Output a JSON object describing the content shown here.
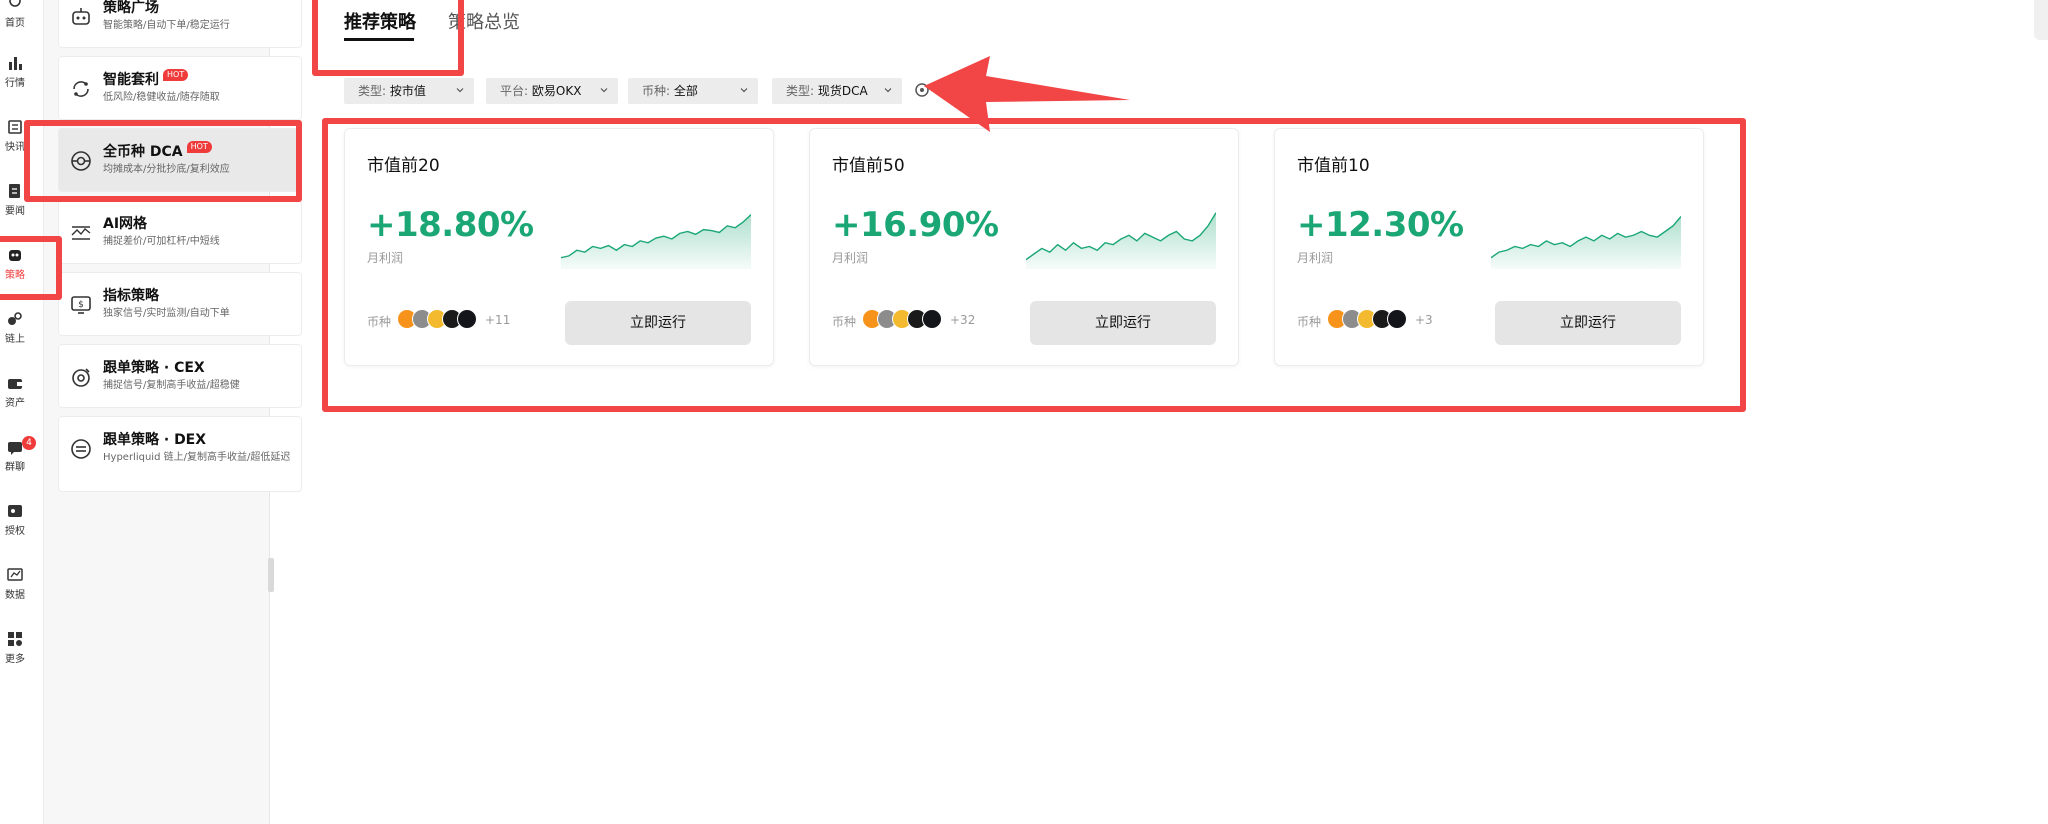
{
  "rail": {
    "items": [
      {
        "label": "首页",
        "icon": "home-icon"
      },
      {
        "label": "行情",
        "icon": "chart-bar-icon"
      },
      {
        "label": "快讯",
        "icon": "news-icon"
      },
      {
        "label": "要闻",
        "icon": "document-icon"
      },
      {
        "label": "策略",
        "icon": "robot-icon",
        "active": true
      },
      {
        "label": "链上",
        "icon": "chain-icon"
      },
      {
        "label": "资产",
        "icon": "wallet-icon"
      },
      {
        "label": "群聊",
        "icon": "chat-icon",
        "badge": "4"
      },
      {
        "label": "授权",
        "icon": "key-icon"
      },
      {
        "label": "数据",
        "icon": "data-icon"
      },
      {
        "label": "更多",
        "icon": "grid-icon"
      }
    ]
  },
  "menu": {
    "items": [
      {
        "title": "策略广场",
        "desc": "智能策略/自动下单/稳定运行",
        "icon": "robot-icon"
      },
      {
        "title": "智能套利",
        "desc": "低风险/稳健收益/随存随取",
        "icon": "cycle-icon",
        "hot": "HOT"
      },
      {
        "title": "全币种 DCA",
        "desc": "均摊成本/分批抄底/复利效应",
        "icon": "dca-icon",
        "hot": "HOT",
        "active": true
      },
      {
        "title": "AI网格",
        "desc": "捕捉差价/可加杠杆/中短线",
        "icon": "grid-trade-icon"
      },
      {
        "title": "指标策略",
        "desc": "独家信号/实时监测/自动下单",
        "icon": "indicator-icon"
      },
      {
        "title": "跟单策略 · CEX",
        "desc": "捕捉信号/复制高手收益/超稳健",
        "icon": "copy-cex-icon"
      },
      {
        "title": "跟单策略 · DEX",
        "desc": "Hyperliquid 链上/复制高手收益/超低延迟",
        "icon": "copy-dex-icon"
      }
    ]
  },
  "tabs": [
    {
      "label": "推荐策略",
      "active": true
    },
    {
      "label": "策略总览"
    }
  ],
  "filters": [
    {
      "prefix": "类型:",
      "value": "按市值"
    },
    {
      "prefix": "平台:",
      "value": "欧易OKX"
    },
    {
      "prefix": "币种:",
      "value": "全部"
    },
    {
      "prefix": "类型:",
      "value": "现货DCA"
    }
  ],
  "cards": [
    {
      "title": "市值前20",
      "pct": "+18.80%",
      "pct_label": "月利润",
      "coins_label": "币种",
      "more": "+11",
      "run": "立即运行",
      "spark": [
        12,
        14,
        20,
        18,
        24,
        22,
        25,
        20,
        26,
        24,
        30,
        28,
        33,
        35,
        32,
        38,
        40,
        37,
        42,
        41,
        39,
        46,
        44,
        50,
        58
      ],
      "coins": [
        "#f7931a",
        "#8c8c8c",
        "#f3ba2f",
        "#1a1a1a",
        "#14151a"
      ]
    },
    {
      "title": "市值前50",
      "pct": "+16.90%",
      "pct_label": "月利润",
      "coins_label": "币种",
      "more": "+32",
      "run": "立即运行",
      "spark": [
        10,
        16,
        22,
        18,
        26,
        20,
        28,
        22,
        24,
        20,
        28,
        26,
        32,
        36,
        30,
        38,
        34,
        30,
        36,
        40,
        32,
        30,
        36,
        46,
        60
      ],
      "coins": [
        "#f7931a",
        "#8c8c8c",
        "#f3ba2f",
        "#1a1a1a",
        "#14151a"
      ]
    },
    {
      "title": "市值前10",
      "pct": "+12.30%",
      "pct_label": "月利润",
      "coins_label": "币种",
      "more": "+3",
      "run": "立即运行",
      "spark": [
        12,
        18,
        20,
        24,
        22,
        26,
        24,
        30,
        26,
        28,
        24,
        30,
        34,
        30,
        36,
        32,
        38,
        34,
        36,
        40,
        36,
        34,
        40,
        46,
        56
      ],
      "coins": [
        "#f7931a",
        "#8c8c8c",
        "#f3ba2f",
        "#1a1a1a",
        "#14151a"
      ]
    }
  ],
  "colors": {
    "accent_green": "#1ba775",
    "annotation_red": "#f24545",
    "hot_red": "#f03b3b"
  }
}
